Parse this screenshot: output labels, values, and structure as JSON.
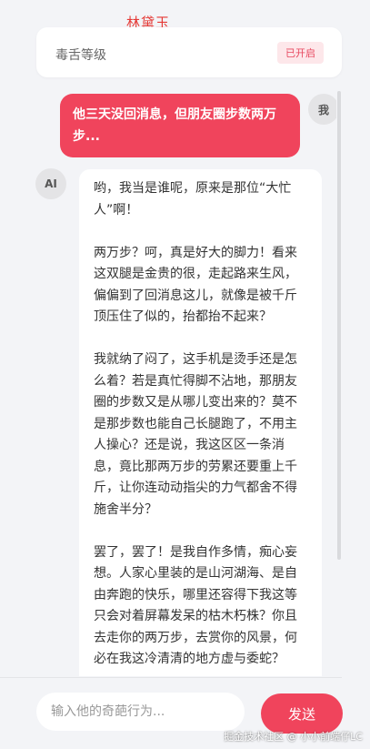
{
  "header": {
    "title": "林黛玉"
  },
  "level": {
    "label": "毒舌等级",
    "badge": "已开启"
  },
  "messages": {
    "user_avatar": "我",
    "user_text": "他三天没回消息，但朋友圈步数两万步...",
    "ai_avatar": "AI",
    "ai_paragraphs": [
      "哟，我当是谁呢，原来是那位“大忙人”啊！",
      "两万步？呵，真是好大的脚力！看来这双腿是金贵的很，走起路来生风，偏偏到了回消息这儿，就像是被千斤顶压住了似的，抬都抬不起来？",
      "我就纳了闷了，这手机是烫手还是怎么着？若是真忙得脚不沾地，那朋友圈的步数又是从哪儿变出来的？莫不是那步数也能自己长腿跑了，不用主人操心？还是说，我这区区一条消息，竟比那两万步的劳累还要重上千斤，让你连动动指尖的力气都舍不得施舍半分？",
      "罢了，罢了！是我自作多情，痴心妄想。人家心里装的是山河湖海、是自由奔跑的快乐，哪里还容得下我这等只会对着屏幕发呆的枯木朽株？你且去走你的两万步，去赏你的风景，何必在我这冷清清的地方虚与委蛇？"
    ]
  },
  "composer": {
    "placeholder": "输入他的奇葩行为...",
    "send_label": "发送"
  },
  "watermark": "掘金技术社区 @ 小小前端仔LC",
  "colors": {
    "accent": "#f0445c",
    "title": "#e53935",
    "badge_bg": "#fde7ea"
  }
}
